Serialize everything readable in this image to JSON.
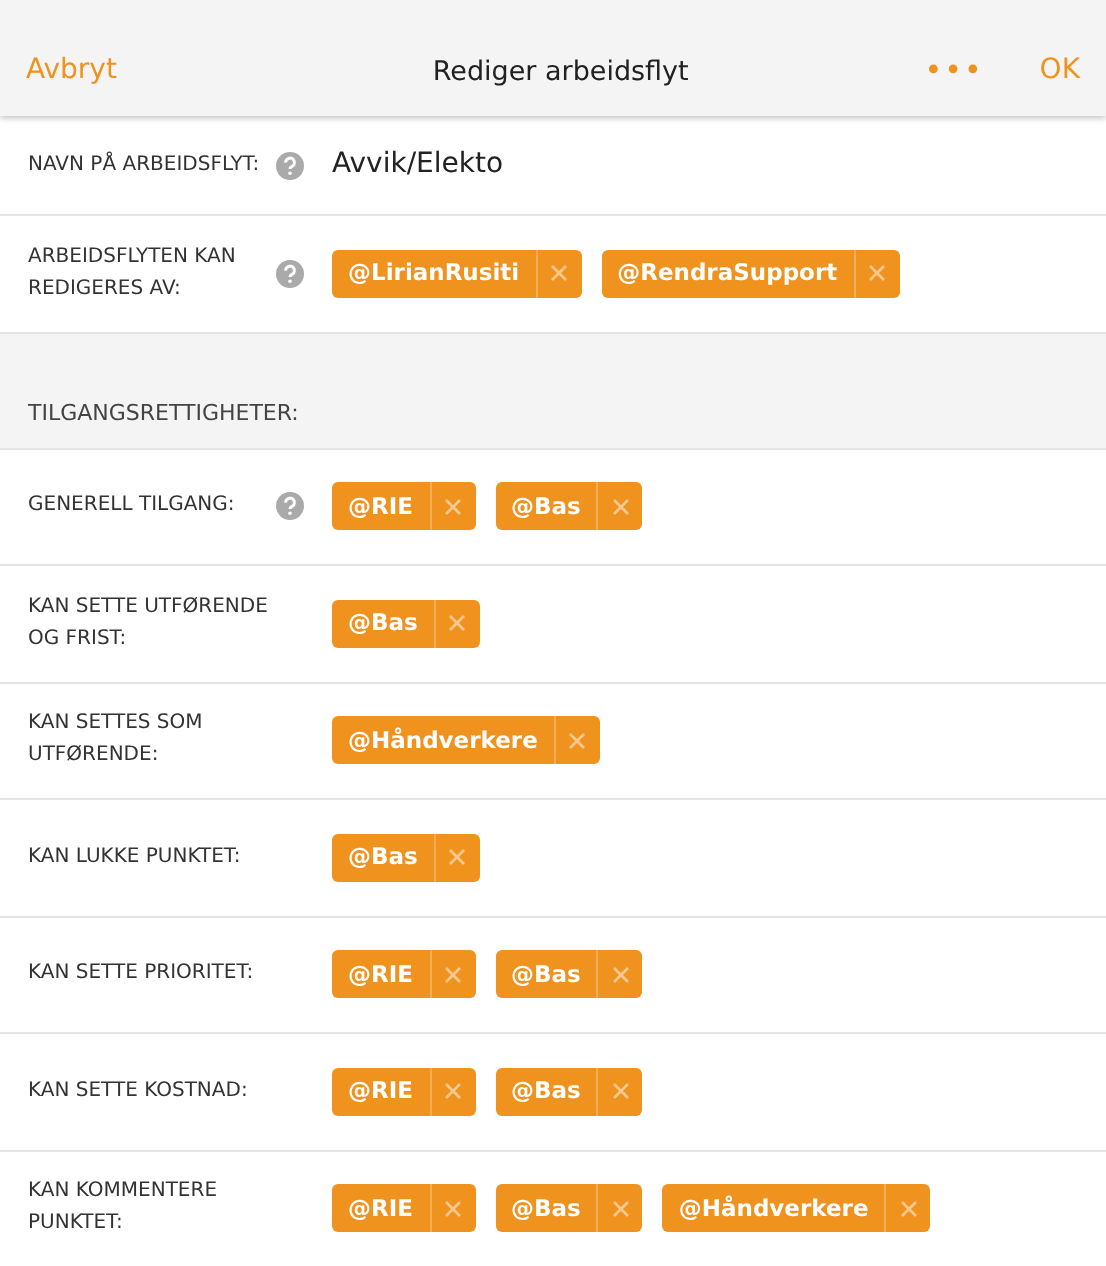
{
  "header": {
    "cancel": "Avbryt",
    "title": "Rediger arbeidsflyt",
    "more": "•••",
    "ok": "OK"
  },
  "general": [
    {
      "label": "NAVN PÅ ARBEIDSFLYT:",
      "help": true,
      "kind": "text",
      "value": "Avvik/Elekto"
    },
    {
      "label": "ARBEIDSFLYTEN KAN REDIGERES AV:",
      "help": true,
      "kind": "tags",
      "tags": [
        "@LirianRusiti",
        "@RendraSupport"
      ]
    }
  ],
  "section_title": "TILGANGSRETTIGHETER:",
  "permissions": [
    {
      "label": "GENERELL TILGANG:",
      "help": true,
      "kind": "tags",
      "tags": [
        "@RIE",
        "@Bas"
      ]
    },
    {
      "label": "KAN SETTE UTFØRENDE OG FRIST:",
      "help": false,
      "kind": "tags",
      "tags": [
        "@Bas"
      ]
    },
    {
      "label": "KAN SETTES SOM UTFØRENDE:",
      "help": false,
      "kind": "tags",
      "tags": [
        "@Håndverkere"
      ]
    },
    {
      "label": "KAN LUKKE PUNKTET:",
      "help": false,
      "kind": "tags",
      "tags": [
        "@Bas"
      ]
    },
    {
      "label": "KAN SETTE PRIORITET:",
      "help": false,
      "kind": "tags",
      "tags": [
        "@RIE",
        "@Bas"
      ]
    },
    {
      "label": "KAN SETTE KOSTNAD:",
      "help": false,
      "kind": "tags",
      "tags": [
        "@RIE",
        "@Bas"
      ]
    },
    {
      "label": "KAN KOMMENTERE PUNKTET:",
      "help": false,
      "kind": "tags",
      "tags": [
        "@RIE",
        "@Bas",
        "@Håndverkere"
      ]
    }
  ]
}
